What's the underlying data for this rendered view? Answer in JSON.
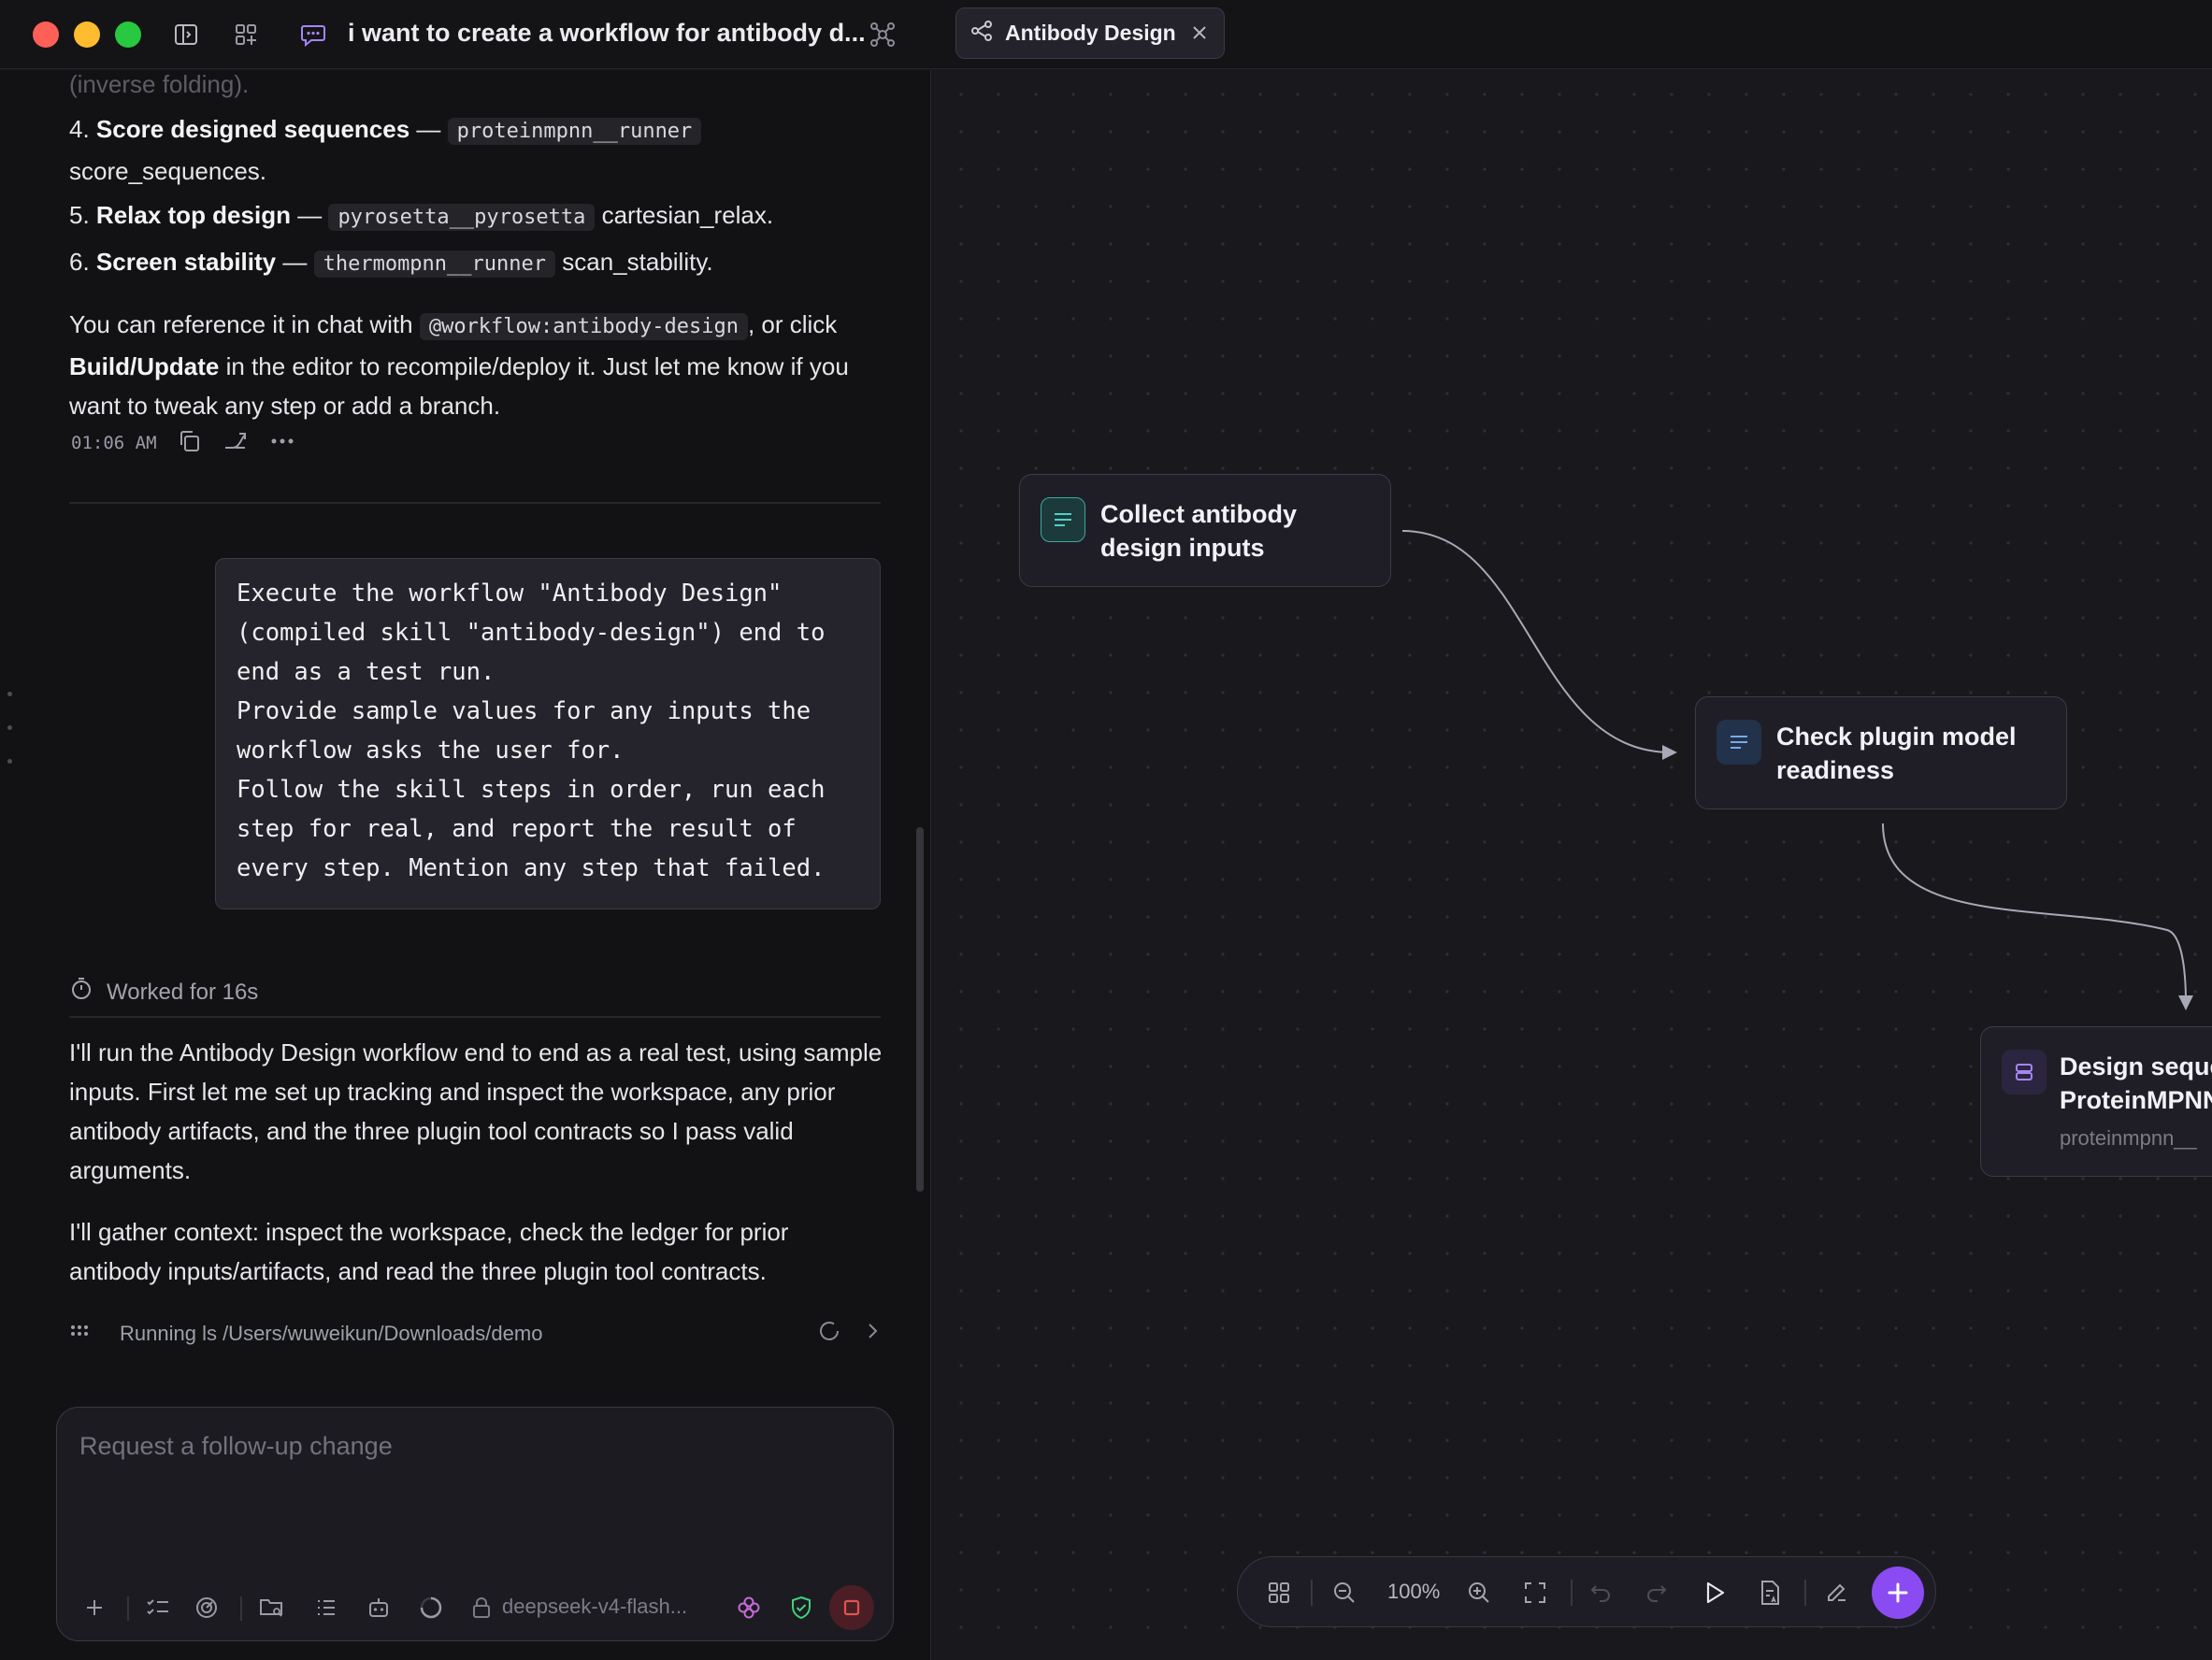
{
  "window": {
    "conversation_title": "i want to create a workflow for antibody d...",
    "tab_label": "Antibody Design"
  },
  "chat": {
    "cut_line": "(inverse folding).",
    "steps": [
      {
        "num": "4.",
        "title": "Score designed sequences",
        "sep": "—",
        "tool": "proteinmpnn__runner",
        "action": "score_sequences."
      },
      {
        "num": "5.",
        "title": "Relax top design",
        "sep": "—",
        "tool": "pyrosetta__pyrosetta",
        "action": "cartesian_relax."
      },
      {
        "num": "6.",
        "title": "Screen stability",
        "sep": "—",
        "tool": "thermompnn__runner",
        "action": "scan_stability."
      }
    ],
    "reference": {
      "before": "You can reference it in chat with",
      "code": "@workflow:antibody-design",
      "after_code": ", or click",
      "bold": "Build/Update",
      "rest": "in the editor to recompile/deploy it. Just let me know if you want to tweak any step or add a branch."
    },
    "timestamp": "01:06 AM",
    "user_message": "Execute the workflow \"Antibody Design\"\n(compiled skill \"antibody-design\") end to\nend as a test run.\nProvide sample values for any inputs the\nworkflow asks the user for.\nFollow the skill steps in order, run each\nstep for real, and report the result of\nevery step. Mention any step that failed.",
    "worked_for": "Worked for 16s",
    "assistant_p1": "I'll run the Antibody Design workflow end to end as a real test, using sample inputs. First let me set up tracking and inspect the workspace, any prior antibody artifacts, and the three plugin tool contracts so I pass valid arguments.",
    "assistant_p2": "I'll gather context: inspect the workspace, check the ledger for prior antibody inputs/artifacts, and read the three plugin tool contracts.",
    "running": "Running ls /Users/wuweikun/Downloads/demo"
  },
  "composer": {
    "placeholder": "Request a follow-up change",
    "model": "deepseek-v4-flash..."
  },
  "canvas": {
    "nodes": [
      {
        "title_line1": "Collect antibody",
        "title_line2": "design inputs",
        "icon": "text-lines-icon"
      },
      {
        "title_line1": "Check plugin model",
        "title_line2": "readiness",
        "icon": "text-lines-icon"
      },
      {
        "title_line1": "Design seque",
        "title_line2": "ProteinMPNN",
        "subtitle": "proteinmpnn__",
        "icon": "database-icon"
      }
    ],
    "zoom": "100%"
  },
  "colors": {
    "accent_purple": "#8a4cf2",
    "node_teal": "#4fd1c5",
    "stop_red": "#e0554f",
    "shield_green": "#3fd37a"
  }
}
